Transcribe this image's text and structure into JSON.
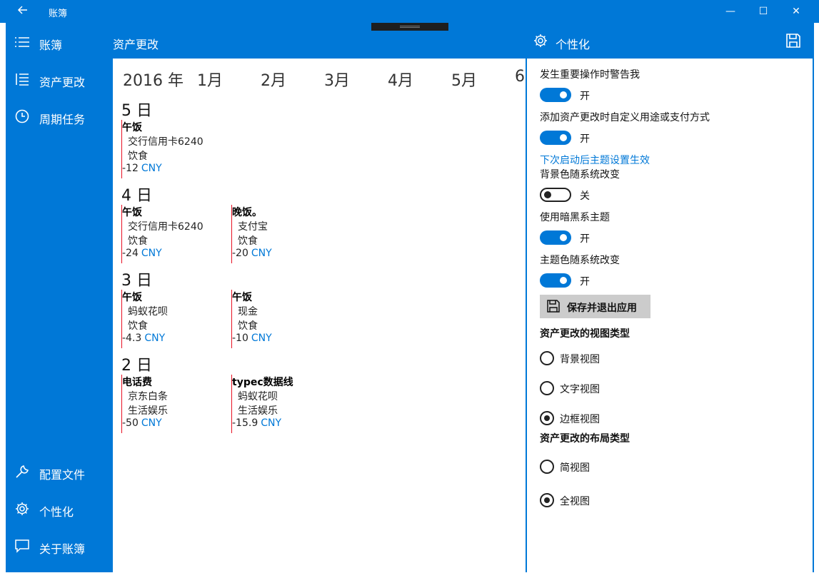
{
  "titlebar": {
    "back_icon": "back-arrow-icon",
    "title": "账簿",
    "minimize": "—",
    "maximize": "☐",
    "close": "✕"
  },
  "nav": {
    "items": [
      {
        "label": "账簿",
        "icon": "hamburger-icon"
      },
      {
        "label": "资产更改",
        "icon": "list-icon"
      },
      {
        "label": "周期任务",
        "icon": "clock-icon"
      }
    ],
    "bottom_items": [
      {
        "label": "配置文件",
        "icon": "wrench-icon"
      },
      {
        "label": "个性化",
        "icon": "gear-icon"
      },
      {
        "label": "关于账簿",
        "icon": "chat-icon"
      }
    ]
  },
  "main": {
    "header": "资产更改",
    "year": "2016 年",
    "months": [
      "1月",
      "2月",
      "3月",
      "4月",
      "5月",
      "6"
    ],
    "days": [
      {
        "label": "5 日",
        "entries": [
          {
            "title": "午饭",
            "account": "交行信用卡6240",
            "category": "饮食",
            "amount": "-12",
            "currency": "CNY"
          }
        ]
      },
      {
        "label": "4 日",
        "entries": [
          {
            "title": "午饭",
            "account": "交行信用卡6240",
            "category": "饮食",
            "amount": "-24",
            "currency": "CNY"
          },
          {
            "title": "晚饭。",
            "account": "支付宝",
            "category": "饮食",
            "amount": "-20",
            "currency": "CNY"
          }
        ]
      },
      {
        "label": "3 日",
        "entries": [
          {
            "title": "午饭",
            "account": "蚂蚁花呗",
            "category": "饮食",
            "amount": "-4.3",
            "currency": "CNY"
          },
          {
            "title": "午饭",
            "account": "现金",
            "category": "饮食",
            "amount": "-10",
            "currency": "CNY"
          }
        ]
      },
      {
        "label": "2 日",
        "entries": [
          {
            "title": "电话费",
            "account": "京东白条",
            "category": "生活娱乐",
            "amount": "-50",
            "currency": "CNY"
          },
          {
            "title": "typec数据线",
            "account": "蚂蚁花呗",
            "category": "生活娱乐",
            "amount": "-15.9",
            "currency": "CNY"
          }
        ]
      }
    ]
  },
  "settings": {
    "header": "个性化",
    "toggles": [
      {
        "label": "发生重要操作时警告我",
        "on": true,
        "state": "开"
      },
      {
        "label": "添加资产更改时自定义用途或支付方式",
        "on": true,
        "state": "开"
      },
      {
        "label": "背景色随系统改变",
        "on": false,
        "state": "关"
      },
      {
        "label": "使用暗黑系主题",
        "on": true,
        "state": "开"
      },
      {
        "label": "主题色随系统改变",
        "on": true,
        "state": "开"
      }
    ],
    "notice": "下次启动后主题设置生效",
    "save_button": "保存并退出应用",
    "view_type": {
      "title": "资产更改的视图类型",
      "options": [
        "背景视图",
        "文字视图",
        "边框视图"
      ],
      "selected": "边框视图"
    },
    "layout_type": {
      "title": "资产更改的布局类型",
      "options": [
        "简视图",
        "全视图"
      ],
      "selected": "全视图"
    }
  },
  "colors": {
    "accent": "#0078d7",
    "entry_border": "#e81123"
  }
}
